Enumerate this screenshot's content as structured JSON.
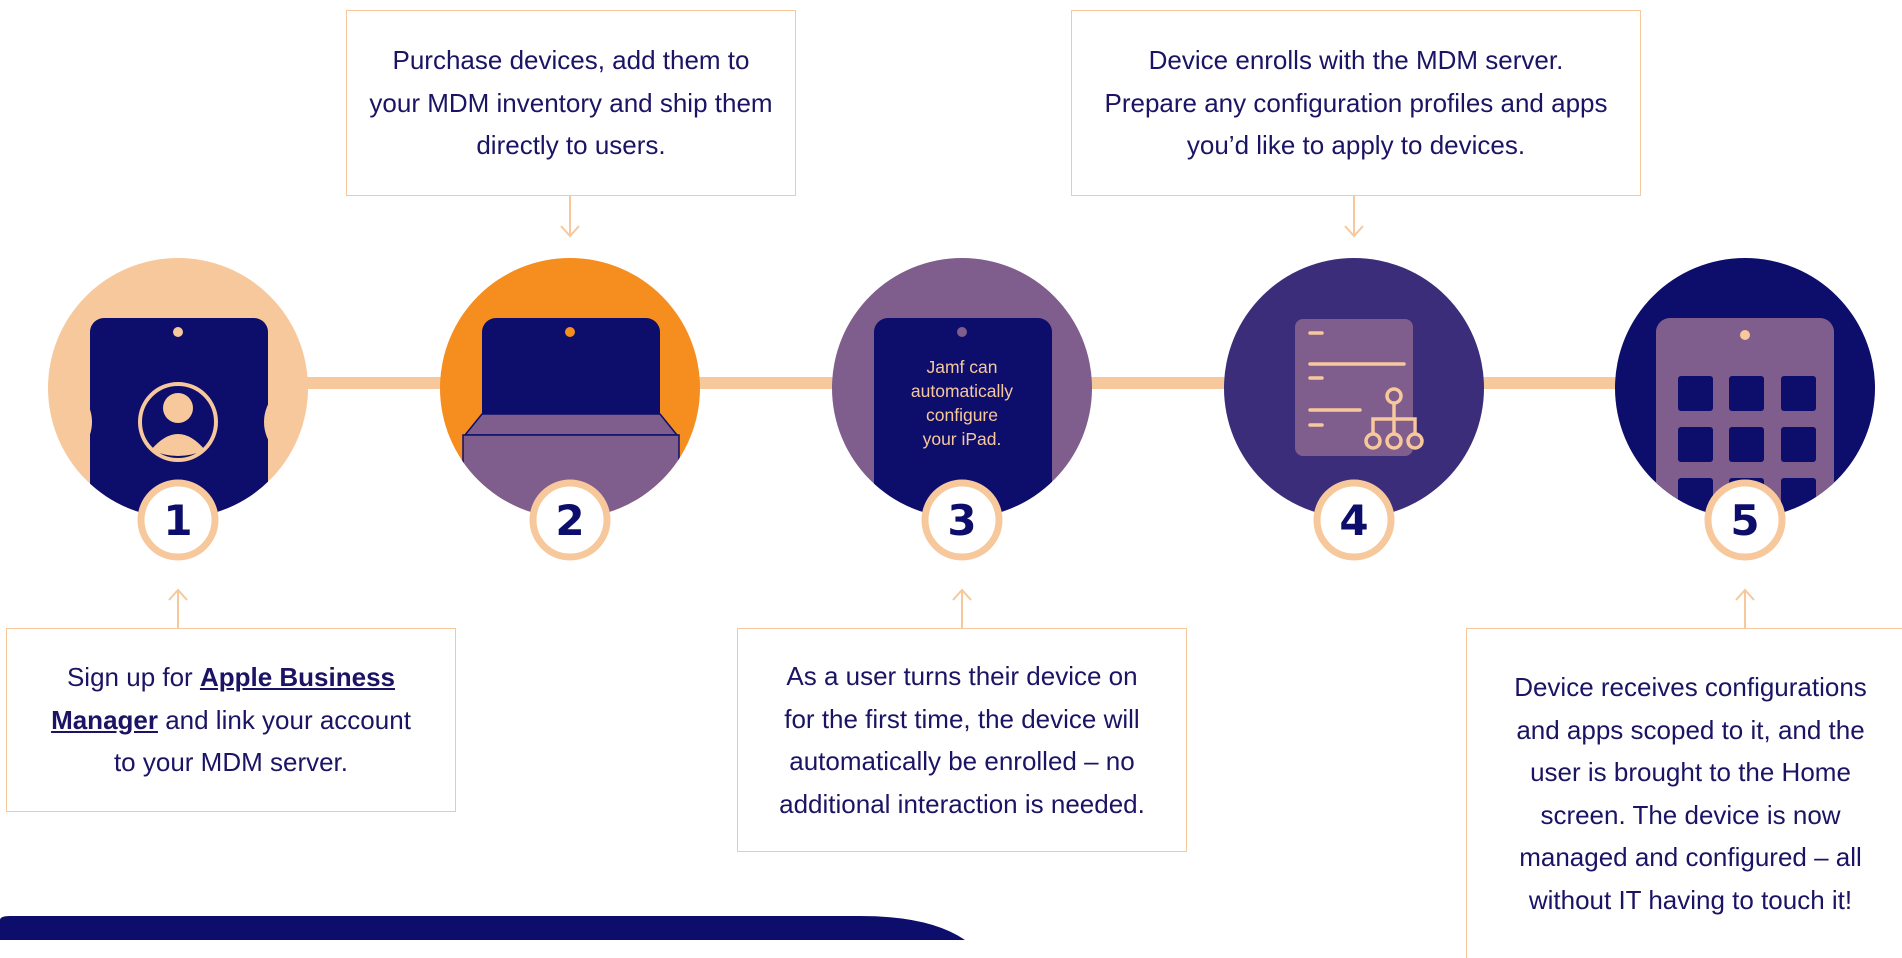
{
  "top_boxes": {
    "purchase": {
      "lines": [
        "Purchase devices, add them to",
        "your MDM inventory and ship them",
        "directly to users."
      ]
    },
    "enroll": {
      "lines": [
        "Device enrolls with the MDM server.",
        "Prepare any configuration profiles and apps",
        "you’d like to apply to devices."
      ]
    }
  },
  "bottom_boxes": {
    "signup": {
      "prefix": "Sign up for ",
      "link_line1": "Apple Business",
      "link_line2": "Manager",
      "suffix": " and link your account",
      "last_line": "to your MDM server."
    },
    "first_boot": {
      "lines": [
        "As a user turns their device on",
        "for the first time, the device will",
        "automatically be enrolled – no",
        "additional interaction is needed."
      ]
    },
    "receive": {
      "lines": [
        "Device receives configurations",
        "and apps scoped to it, and the",
        "user is brought to the Home",
        "screen. The device is now",
        "managed and configured – all",
        "without IT having to touch it!"
      ]
    }
  },
  "steps": [
    {
      "number": "1"
    },
    {
      "number": "2"
    },
    {
      "number": "3",
      "caption": [
        "Jamf can",
        "automatically",
        "configure",
        "your iPad."
      ]
    },
    {
      "number": "4"
    },
    {
      "number": "5"
    }
  ],
  "colors": {
    "navy": "#0d0e6b",
    "text": "#1b1464",
    "peach": "#f7c89b",
    "orange": "#f68d1f",
    "purple": "#7f5d8c",
    "indigo": "#3c2d7a",
    "border": "#f7c89b"
  },
  "icons": [
    "user-avatar-icon",
    "device-box-icon",
    "device-message-icon",
    "profile-hierarchy-icon",
    "app-grid-icon"
  ]
}
